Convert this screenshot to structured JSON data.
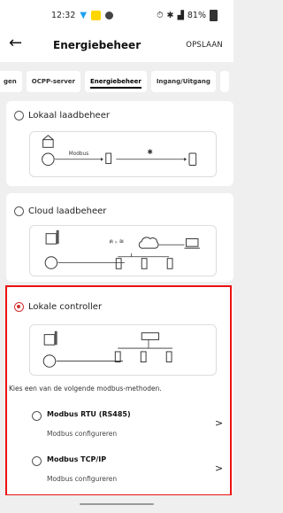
{
  "status": {
    "time": "12:32",
    "battery": "81%"
  },
  "header": {
    "title": "Energiebeheer",
    "save": "OPSLAAN"
  },
  "tabs": [
    "gen",
    "OCPP-server",
    "Energiebeheer",
    "Ingang/Uitgang"
  ],
  "active_tab": "Energiebeheer",
  "options": [
    {
      "label": "Lokaal laadbeheer",
      "selected": false,
      "diagram_text": "Modbus"
    },
    {
      "label": "Cloud laadbeheer",
      "selected": false
    },
    {
      "label": "Lokale controller",
      "selected": true
    }
  ],
  "instruction": "Kies een van de volgende modbus-methoden.",
  "methods": [
    {
      "title": "Modbus RTU (RS485)",
      "subtitle": "Modbus configureren"
    },
    {
      "title": "Modbus TCP/IP",
      "subtitle": "Modbus configureren"
    }
  ],
  "colors": {
    "highlight": "#e11111",
    "selected_radio": "#d32f2f"
  }
}
